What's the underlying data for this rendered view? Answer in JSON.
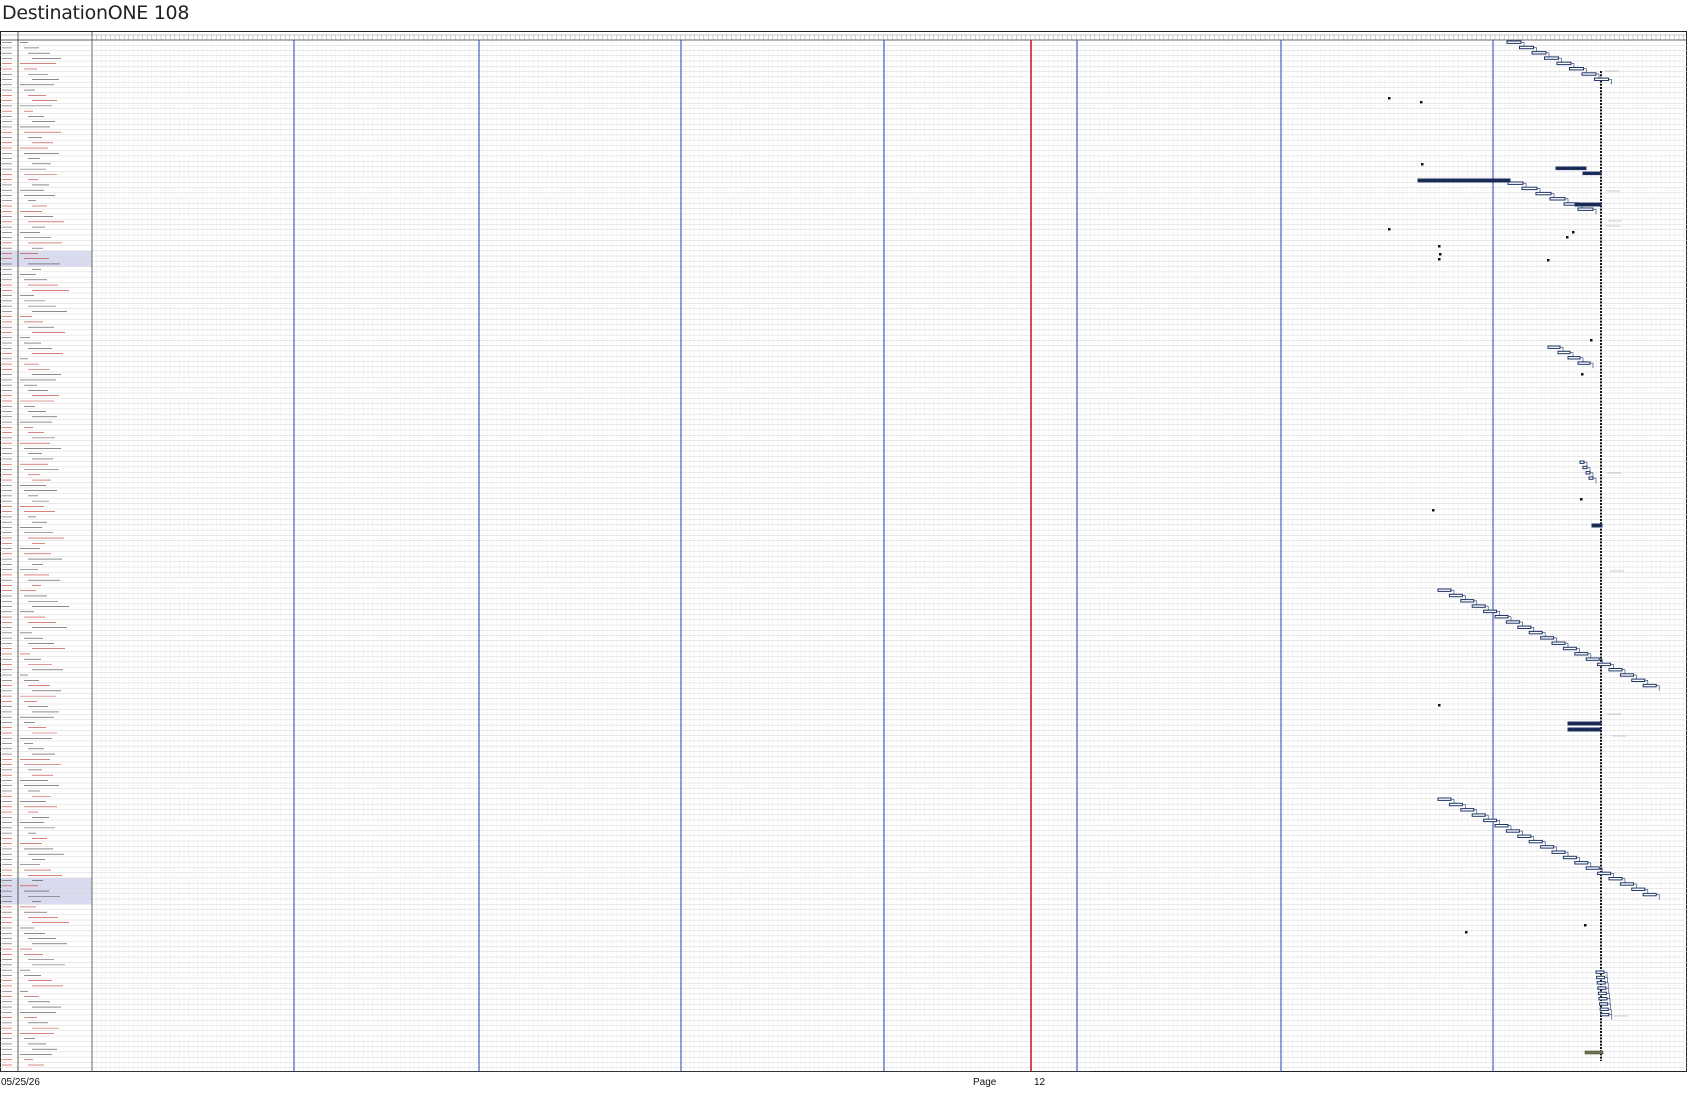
{
  "document": {
    "title": "DestinationONE 108"
  },
  "footer": {
    "date": "05/25/26",
    "page_label": "Page",
    "page_number": "12"
  },
  "colors": {
    "grid_minor": "#d6d6d6",
    "grid_dotted": "#c8c8c8",
    "month_line": "#2a3fb0",
    "today_line": "#d41e1e",
    "task_bar": "#1f3566",
    "task_bar_fill": "#ffffff",
    "summary_bar": "#17274f",
    "milestone": "#111111",
    "id_text_red": "#c0392b",
    "row_highlight": "#d9dcf0",
    "progress_bar": "#6d7a4e"
  }
}
